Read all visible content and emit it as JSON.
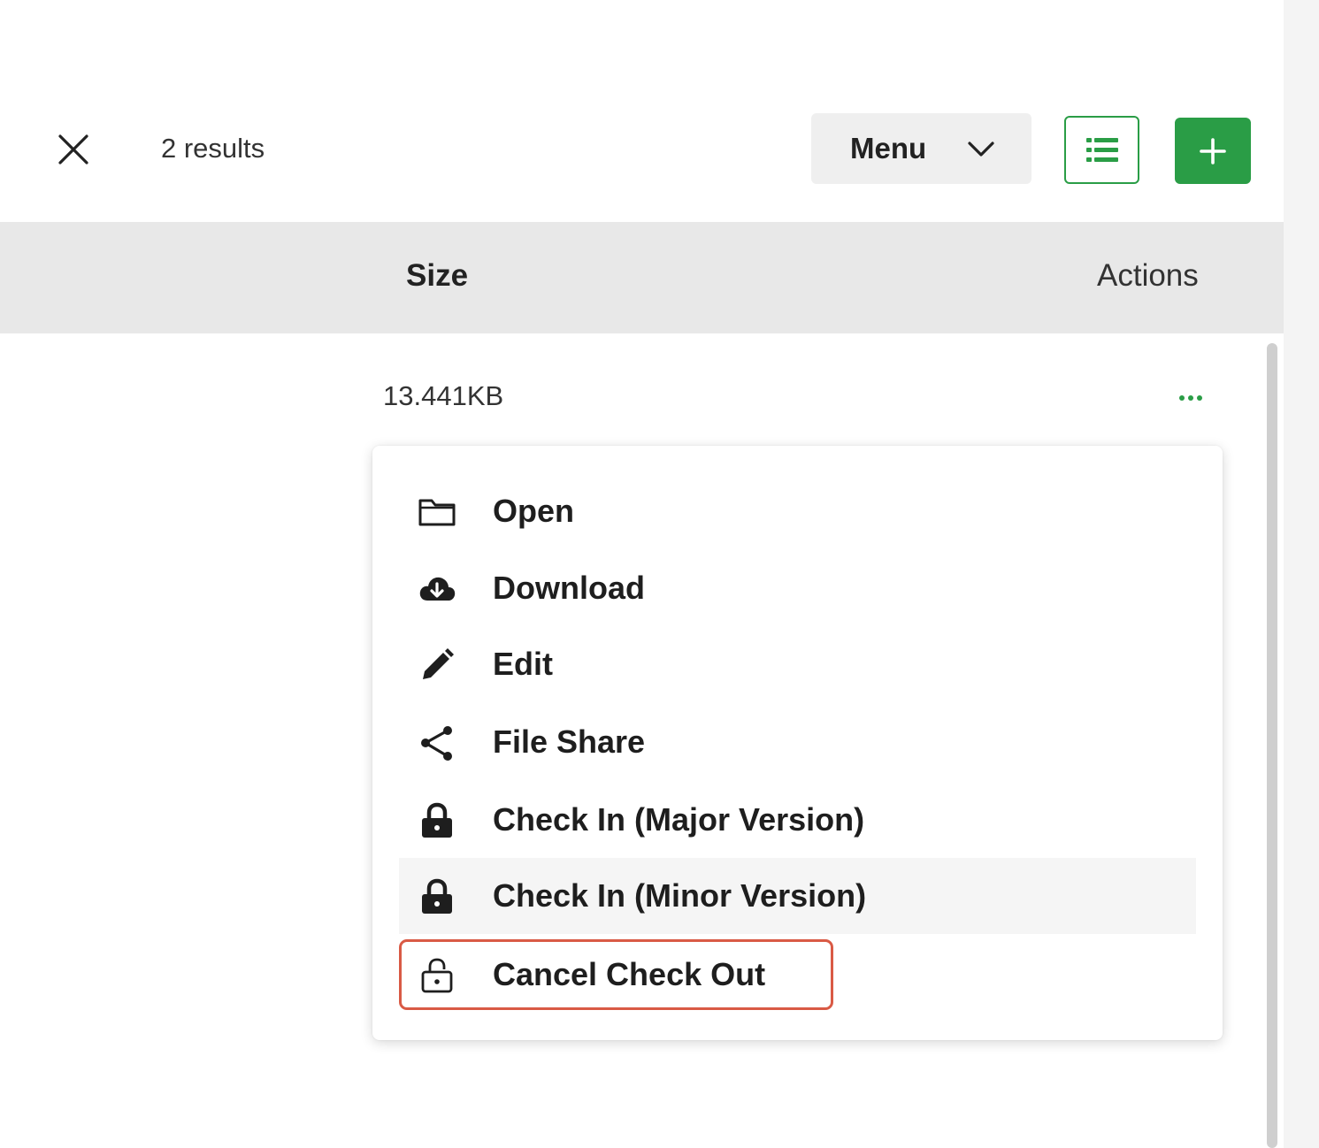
{
  "toolbar": {
    "close_icon": "close-icon",
    "results_text": "2 results",
    "menu_label": "Menu",
    "menu_icon": "chevron-down-icon",
    "list_view_icon": "list-icon",
    "add_icon": "plus-icon"
  },
  "table": {
    "columns": [
      "Size",
      "Actions"
    ],
    "rows": [
      {
        "size": "13.441KB",
        "actions_icon": "more-horizontal-icon"
      }
    ]
  },
  "dropdown": {
    "items": [
      {
        "label": "Open",
        "icon": "folder-icon"
      },
      {
        "label": "Download",
        "icon": "cloud-download-icon"
      },
      {
        "label": "Edit",
        "icon": "pencil-icon"
      },
      {
        "label": "File Share",
        "icon": "share-icon"
      },
      {
        "label": "Check In (Major Version)",
        "icon": "lock-icon"
      },
      {
        "label": "Check In (Minor Version)",
        "icon": "lock-icon",
        "hovered": true
      },
      {
        "label": "Cancel Check Out",
        "icon": "unlock-icon",
        "highlighted": true
      }
    ]
  },
  "colors": {
    "accent": "#2a9d46",
    "highlight_border": "#d95a45",
    "header_bg": "#e8e8e8"
  }
}
